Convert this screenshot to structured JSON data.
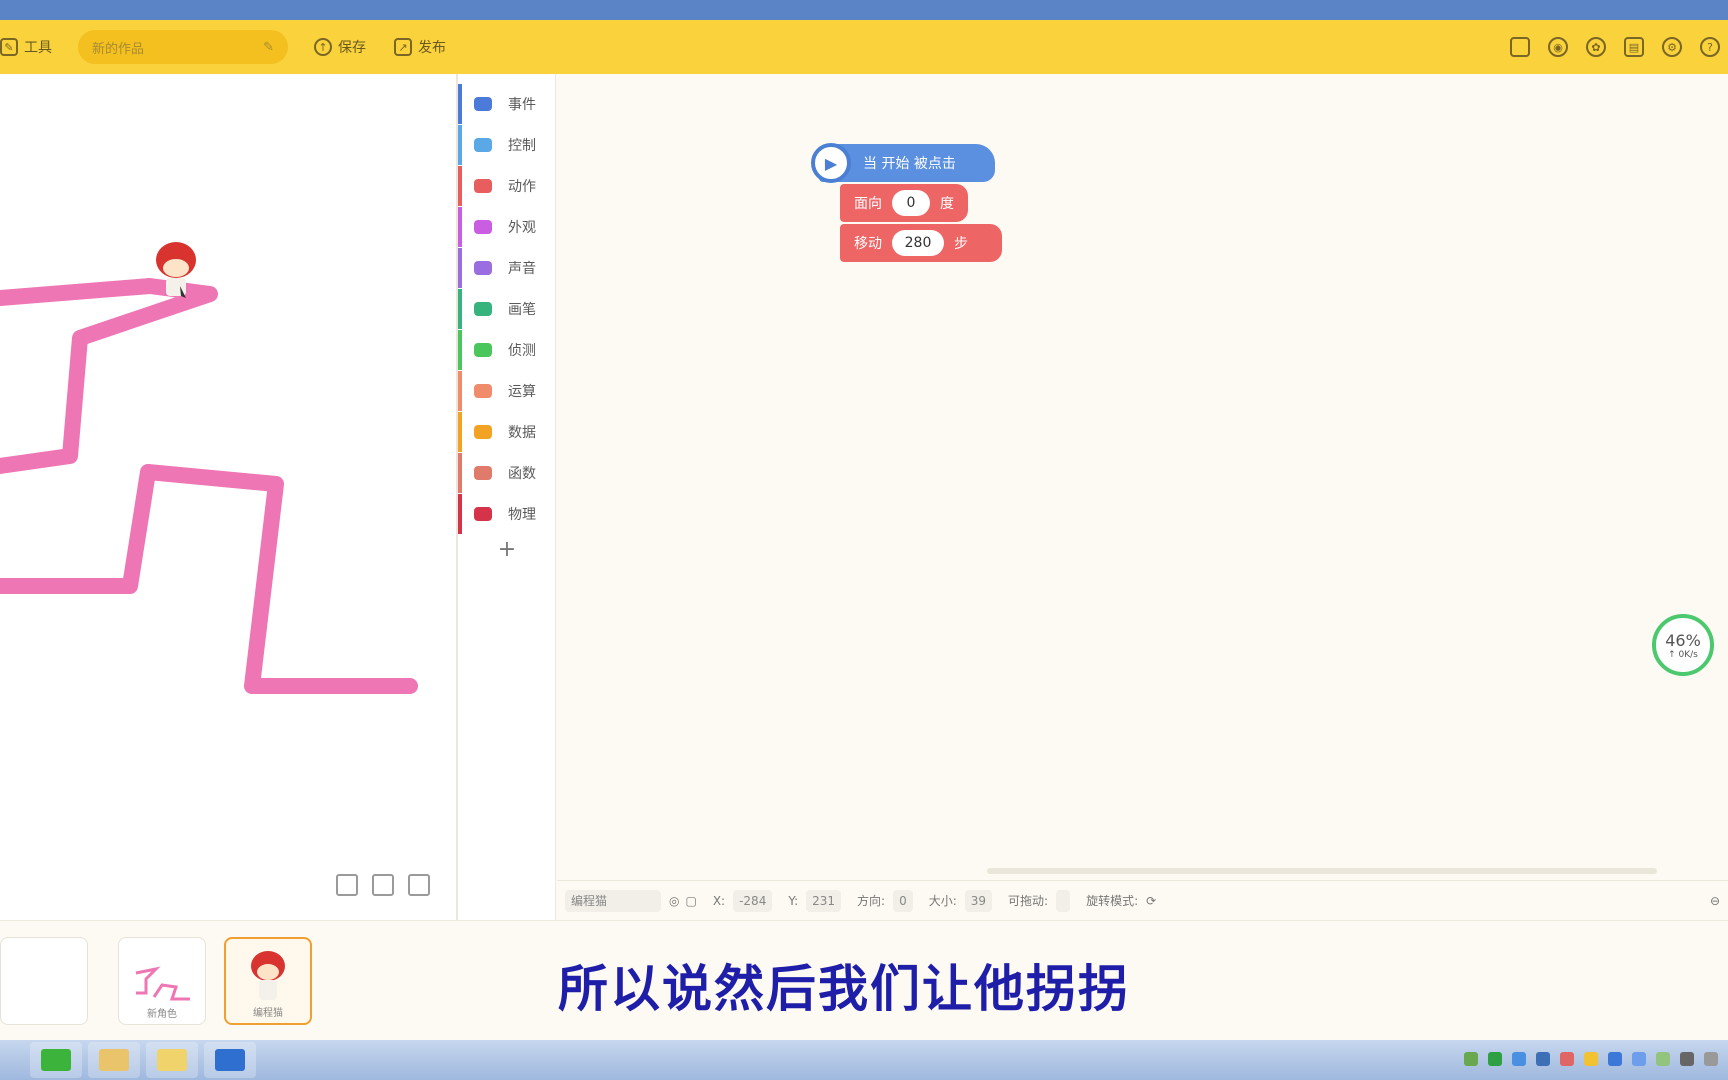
{
  "toolbar": {
    "tools_label": "工具",
    "project_title": "新的作品",
    "save_label": "保存",
    "publish_label": "发布",
    "right_icons": [
      "phone-icon",
      "preview-icon",
      "share-icon",
      "print-icon",
      "gear-icon",
      "help-icon"
    ]
  },
  "categories": [
    {
      "label": "事件",
      "color": "#4c7ad8"
    },
    {
      "label": "控制",
      "color": "#5aa8e6"
    },
    {
      "label": "动作",
      "color": "#e85d5d"
    },
    {
      "label": "外观",
      "color": "#c95ee3"
    },
    {
      "label": "声音",
      "color": "#9a6de0"
    },
    {
      "label": "画笔",
      "color": "#37b37e"
    },
    {
      "label": "侦测",
      "color": "#4ac65c"
    },
    {
      "label": "运算",
      "color": "#f08b6b"
    },
    {
      "label": "数据",
      "color": "#f2a323"
    },
    {
      "label": "函数",
      "color": "#e07a6a"
    },
    {
      "label": "物理",
      "color": "#d4334a"
    }
  ],
  "blocks": {
    "hat_label": "当 开始 被点击",
    "face_prefix": "面向",
    "face_value": "0",
    "face_suffix": "度",
    "move_prefix": "移动",
    "move_value": "280",
    "move_suffix": "步"
  },
  "progress": {
    "percent": "46%",
    "speed": "↑ 0K/s"
  },
  "properties": {
    "sprite_name": "编程猫",
    "x_label": "X:",
    "x_value": "-284",
    "y_label": "Y:",
    "y_value": "231",
    "dir_label": "方向:",
    "dir_value": "0",
    "size_label": "大小:",
    "size_value": "39",
    "drag_label": "可拖动:",
    "rotate_label": "旋转模式:"
  },
  "sprites": [
    {
      "label": ""
    },
    {
      "label": "新角色"
    },
    {
      "label": "编程猫"
    }
  ],
  "caption": "所以说然后我们让他拐拐",
  "colors": {
    "toolbar": "#f9d23c",
    "pen": "#ee76b4",
    "hat_block": "#5b8fe0",
    "motion_block": "#ee6565",
    "caption": "#1e1ea8"
  }
}
